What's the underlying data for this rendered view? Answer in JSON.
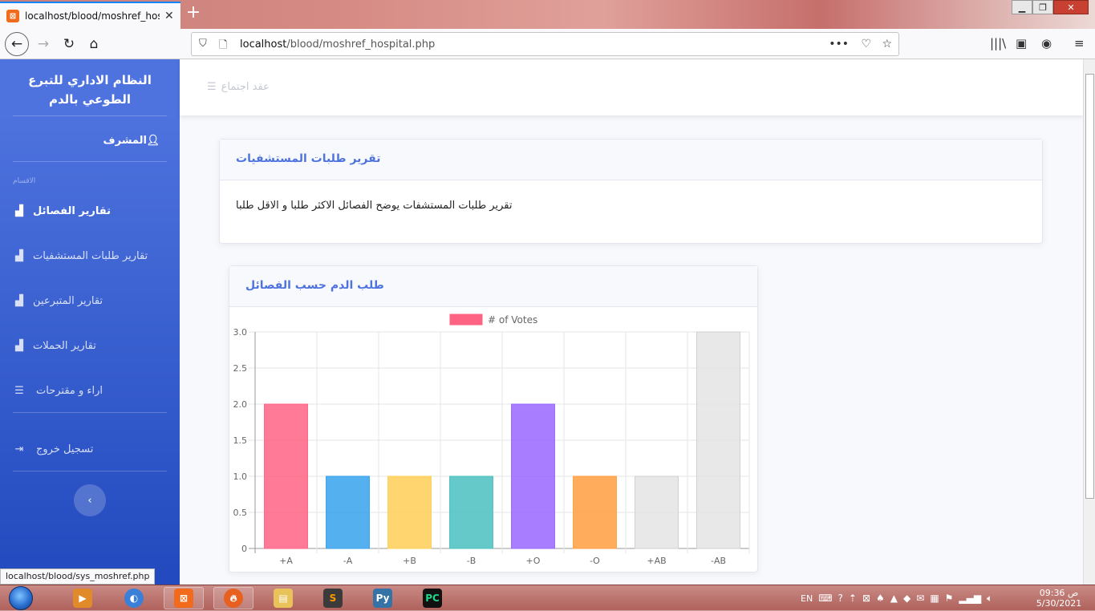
{
  "browser": {
    "tab_title": "localhost/blood/moshref_hospital.php",
    "tab_favicon": "xampp-icon",
    "url_host": "localhost",
    "url_path": "/blood/moshref_hospital.php",
    "status_url": "localhost/blood/sys_moshref.php"
  },
  "sidebar": {
    "brand": "النظام الاداري للتبرع الطوعي بالدم",
    "admin_label": "المشرف",
    "section_heading": "الاقسام",
    "items": [
      {
        "label": "تقارير الفصائل",
        "icon": "area-chart-icon",
        "active": true
      },
      {
        "label": "تقارير طلبات المستشفيات",
        "icon": "area-chart-icon",
        "active": false
      },
      {
        "label": "تقارير المتبرعين",
        "icon": "area-chart-icon",
        "active": false
      },
      {
        "label": "تقارير الحملات",
        "icon": "area-chart-icon",
        "active": false
      },
      {
        "label": "اراء و مقترحات",
        "icon": "list-icon",
        "active": false
      }
    ],
    "logout_label": "تسجيل خروج",
    "toggle_symbol": "‹"
  },
  "topbar": {
    "meeting_link": "عقد اجتماع"
  },
  "report_card": {
    "title": "تقرير طلبات المستشفيات",
    "body": "تقرير طلبات المستشفات يوضح الفصائل الاكثر طلبا و الاقل طلبا"
  },
  "chart_card": {
    "title": "طلب الدم حسب الفصائل"
  },
  "chart_data": {
    "type": "bar",
    "categories": [
      "A+",
      "A-",
      "B+",
      "B-",
      "O+",
      "O-",
      "AB+",
      "AB-"
    ],
    "series": [
      {
        "name": "# of Votes",
        "values": [
          2,
          1,
          1,
          1,
          2,
          1,
          1,
          3
        ]
      }
    ],
    "colors": [
      "#ff6384",
      "#36a2eb",
      "#ffce56",
      "#4bc0c0",
      "#9966ff",
      "#ff9f40",
      "#e4e4e4",
      "#e4e4e4"
    ],
    "ylim": [
      0,
      3
    ],
    "yticks": [
      "0",
      "0.5",
      "1.0",
      "1.5",
      "2.0",
      "2.5",
      "3.0"
    ],
    "legend_position": "top",
    "grid": true
  },
  "taskbar": {
    "lang": "EN",
    "time": "09:36 ص",
    "date": "5/30/2021"
  }
}
